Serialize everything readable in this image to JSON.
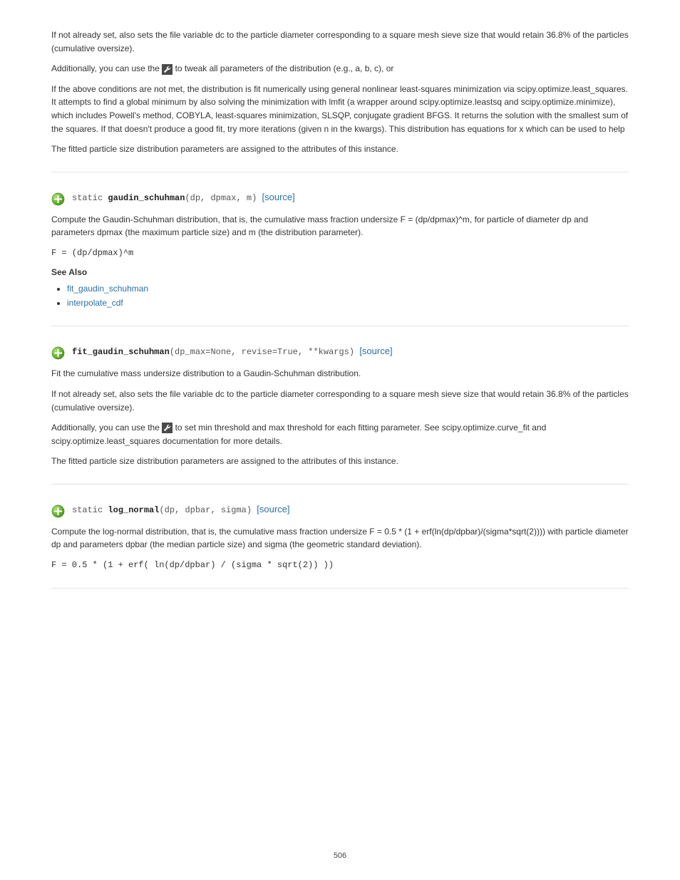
{
  "page_number": "506",
  "sections": [
    {
      "intro_paragraphs": [
        "If not already set, also sets the file variable dc to the particle diameter corresponding to a square mesh sieve size that would retain 36.8% of the particles (cumulative oversize).",
        "Additionally, you can use the <wrench/> to tweak all parameters of the distribution (e.g., a, b, c), or",
        "If the above conditions are not met, the distribution is fit numerically using general nonlinear least-squares minimization via scipy.optimize.least_squares. It attempts to find a global minimum by also solving the minimization with lmfit (a wrapper around scipy.optimize.leastsq and scipy.optimize.minimize), which includes Powell's method, COBYLA, least-squares minimization, SLSQP, conjugate gradient BFGS. It returns the solution with the smallest sum of the squares. If that doesn't produce a good fit, try more iterations (given n in the kwargs). This distribution has equations for x which can be used to help",
        "The fitted particle size distribution parameters are assigned to the attributes of this instance."
      ]
    },
    {
      "decl_prefix": "static ",
      "decl_name": "gaudin_schuhman",
      "decl_sig": "(dp, dpmax, m)",
      "source_link": "[source]",
      "paragraphs": [
        "Compute the Gaudin-Schuhman distribution, that is, the cumulative mass fraction undersize F = (dp/dpmax)^m, for particle of diameter dp and parameters dpmax (the maximum particle size) and m (the distribution parameter).",
        "F = (dp/dpmax)^m"
      ],
      "see_also": {
        "heading": "See Also",
        "items": [
          "fit_gaudin_schuhman",
          "interpolate_cdf"
        ]
      }
    },
    {
      "decl_prefix": "",
      "decl_name": "fit_gaudin_schuhman",
      "decl_sig": "(dp_max=None, revise=True, **kwargs)",
      "source_link": "[source]",
      "paragraphs": [
        "Fit the cumulative mass undersize distribution to a Gaudin-Schuhman distribution.",
        "If not already set, also sets the file variable dc to the particle diameter corresponding to a square mesh sieve size that would retain 36.8% of the particles (cumulative oversize).",
        "Additionally, you can use the <wrench/> to set min threshold and max threshold for each fitting parameter. See scipy.optimize.curve_fit and scipy.optimize.least_squares documentation for more details.",
        "The fitted particle size distribution parameters are assigned to the attributes of this instance."
      ]
    },
    {
      "decl_prefix": "static ",
      "decl_name": "log_normal",
      "decl_sig": "(dp, dpbar, sigma)",
      "source_link": "[source]",
      "paragraphs": [
        "Compute the log-normal distribution, that is, the cumulative mass fraction undersize F = 0.5 * (1 + erf(ln(dp/dpbar)/(sigma*sqrt(2)))) with particle diameter dp and parameters dpbar (the median particle size) and sigma (the geometric standard deviation).",
        "F = 0.5 * (1 + erf( ln(dp/dpbar) / (sigma * sqrt(2)) ))"
      ]
    }
  ]
}
